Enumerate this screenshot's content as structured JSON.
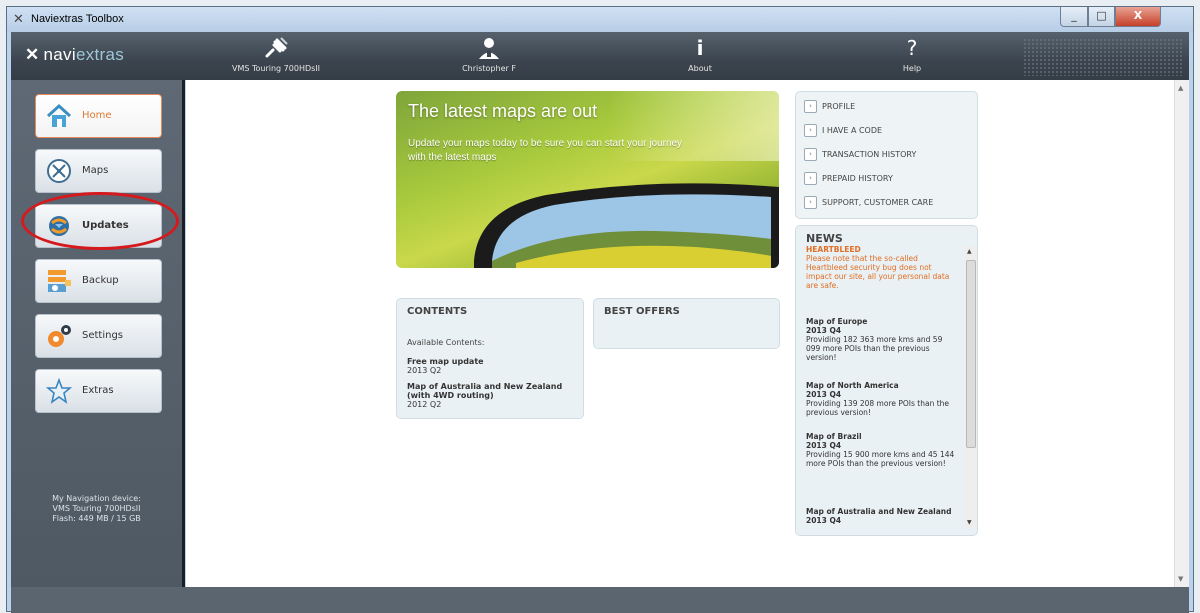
{
  "window": {
    "title": "Naviextras Toolbox",
    "controls": {
      "minimize": "_",
      "maximize": "□",
      "close": "X"
    }
  },
  "brand": {
    "mark": "✕",
    "name_a": "navi",
    "name_b": "extras"
  },
  "topnav": [
    {
      "label": "VMS Touring 700HDsII",
      "icon": "device-plug-icon"
    },
    {
      "label": "Christopher F",
      "icon": "user-icon"
    },
    {
      "label": "About",
      "icon": "info-icon"
    },
    {
      "label": "Help",
      "icon": "help-icon"
    }
  ],
  "sidebar": {
    "items": [
      {
        "label": "Home",
        "icon": "home-icon",
        "active": true
      },
      {
        "label": "Maps",
        "icon": "compass-icon"
      },
      {
        "label": "Updates",
        "icon": "updates-globe-icon",
        "highlighted": true
      },
      {
        "label": "Backup",
        "icon": "backup-icon"
      },
      {
        "label": "Settings",
        "icon": "gear-icon"
      },
      {
        "label": "Extras",
        "icon": "star-icon"
      }
    ],
    "device": {
      "line1": "My Navigation device:",
      "line2": "VMS Touring 700HDsII",
      "line3": "Flash: 449 MB / 15 GB"
    }
  },
  "hero": {
    "title": "The latest maps are out",
    "text": "Update your maps today to be sure you can start your journey with the latest maps"
  },
  "contents": {
    "header": "CONTENTS",
    "sub": "Available Contents:",
    "items": [
      {
        "title": "Free map update",
        "version": "2013 Q2"
      },
      {
        "title": "Map of Australia and New Zealand (with 4WD routing)",
        "version": "2012 Q2"
      }
    ]
  },
  "best_offers": {
    "header": "BEST OFFERS"
  },
  "links": [
    "PROFILE",
    "I HAVE A CODE",
    "TRANSACTION HISTORY",
    "PREPAID HISTORY",
    "SUPPORT, CUSTOMER CARE"
  ],
  "news": {
    "header": "NEWS",
    "items": [
      {
        "title": "HEARTBLEED",
        "body": "Please note that the so-called Heartbleed security bug does not impact our site, all your personal data are safe."
      },
      {
        "title": "Map of Europe",
        "version": "2013 Q4",
        "body": "Providing 182 363 more kms and 59 099 more POIs than the previous version!"
      },
      {
        "title": "Map of North America",
        "version": "2013 Q4",
        "body": "Providing 139 208 more POIs than the previous version!"
      },
      {
        "title": "Map of Brazil",
        "version": "2013 Q4",
        "body": "Providing 15 900 more kms and 45 144 more POIs than the previous version!"
      },
      {
        "title": "Map of Australia and New Zealand",
        "version": "2013 Q4"
      }
    ]
  },
  "colors": {
    "accent": "#e07a2f",
    "highlight": "#d6191d",
    "topbar": "#3c454f"
  }
}
